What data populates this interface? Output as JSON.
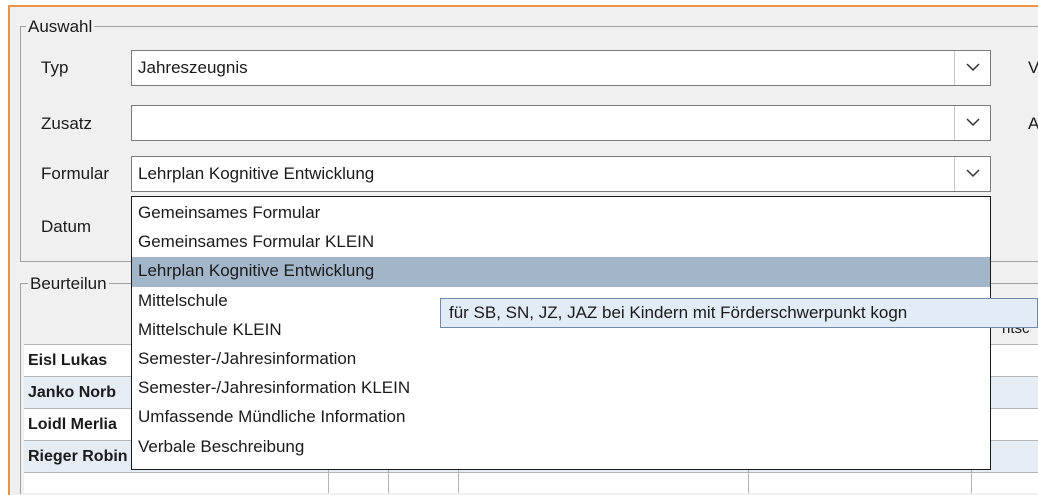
{
  "auswahl": {
    "legend": "Auswahl",
    "typ": {
      "label": "Typ",
      "value": "Jahreszeugnis",
      "right_label": "V"
    },
    "zusatz": {
      "label": "Zusatz",
      "value": "",
      "right_label": "A"
    },
    "formular": {
      "label": "Formular",
      "value": "Lehrplan Kognitive Entwicklung"
    },
    "datum": {
      "label": "Datum"
    }
  },
  "beurteilung": {
    "legend": "Beurteilun",
    "header_fragment": "ntsc",
    "students": [
      "Eisl Lukas",
      "Janko Norb",
      "Loidl Merlia",
      "Rieger Robin"
    ]
  },
  "dropdown": {
    "options": [
      "Gemeinsames Formular",
      "Gemeinsames Formular KLEIN",
      "Lehrplan Kognitive Entwicklung",
      "Mittelschule",
      "Mittelschule KLEIN",
      "Semester-/Jahresinformation",
      "Semester-/Jahresinformation KLEIN",
      "Umfassende Mündliche Information",
      "Verbale Beschreibung"
    ],
    "selected_index": 2
  },
  "tooltip": {
    "text": "für SB, SN, JZ, JAZ bei Kindern mit Förderschwerpunkt kogn"
  },
  "colors": {
    "frame_accent": "#e8944a",
    "selection": "#a3b5c8",
    "tooltip_bg": "#e2ecf6",
    "row_alt": "#e5ecf4"
  }
}
